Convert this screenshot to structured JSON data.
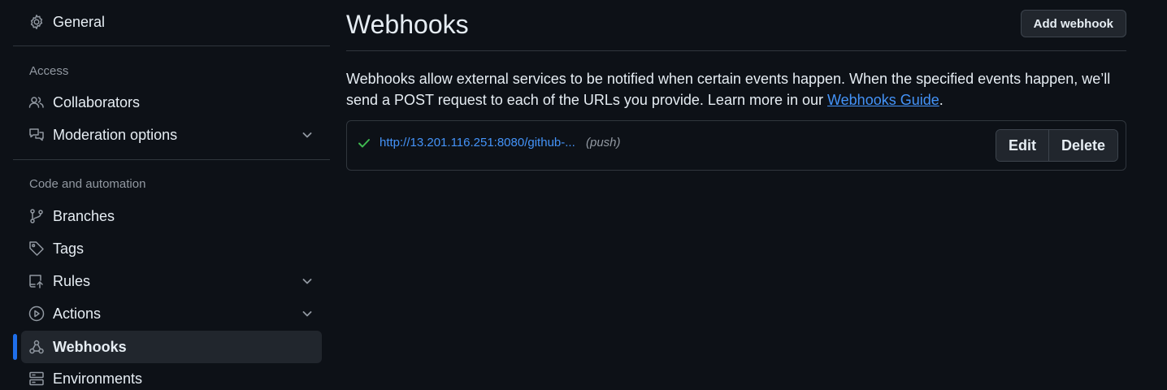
{
  "sidebar": {
    "general": {
      "label": "General",
      "icon": "gear-icon"
    },
    "access_heading": "Access",
    "collaborators": {
      "label": "Collaborators",
      "icon": "people-icon"
    },
    "moderation": {
      "label": "Moderation options",
      "icon": "comment-discussion-icon"
    },
    "code_heading": "Code and automation",
    "branches": {
      "label": "Branches",
      "icon": "git-branch-icon"
    },
    "tags": {
      "label": "Tags",
      "icon": "tag-icon"
    },
    "rules": {
      "label": "Rules",
      "icon": "repo-push-icon"
    },
    "actions": {
      "label": "Actions",
      "icon": "play-icon"
    },
    "webhooks": {
      "label": "Webhooks",
      "icon": "webhook-icon",
      "active": true
    },
    "environments": {
      "label": "Environments",
      "icon": "server-icon"
    }
  },
  "main": {
    "title": "Webhooks",
    "add_button": "Add webhook",
    "description_prefix": "Webhooks allow external services to be notified when certain events happen. When the specified events happen, we’ll send a POST request to each of the URLs you provide. Learn more in our ",
    "description_link": "Webhooks Guide",
    "description_suffix": ".",
    "hooks": [
      {
        "status": "success",
        "url": "http://13.201.116.251:8080/github-...",
        "events": "(push)",
        "edit_label": "Edit",
        "delete_label": "Delete"
      }
    ]
  },
  "colors": {
    "background": "#0d1117",
    "accent": "#1f6feb",
    "link": "#4493f8",
    "success": "#3fb950"
  }
}
